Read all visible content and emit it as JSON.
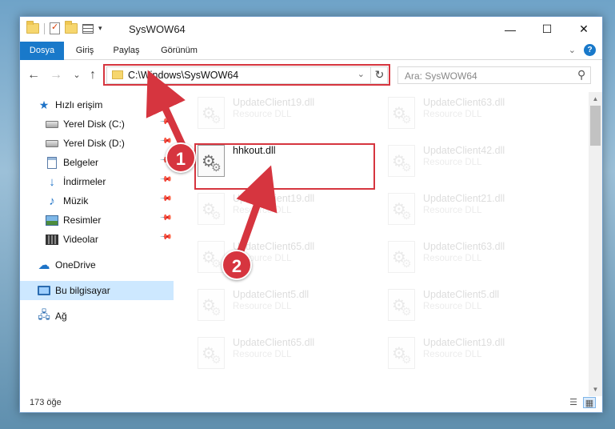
{
  "window": {
    "title": "SysWOW64",
    "controls": {
      "minimize": "—",
      "maximize": "☐",
      "close": "✕"
    }
  },
  "ribbon": {
    "tabs": [
      {
        "label": "Dosya"
      },
      {
        "label": "Giriş"
      },
      {
        "label": "Paylaş"
      },
      {
        "label": "Görünüm"
      }
    ],
    "help_label": "?"
  },
  "navigation": {
    "back_icon": "←",
    "forward_icon": "→",
    "recent_icon": "⌄",
    "up_icon": "↑",
    "address": "C:\\Windows\\SysWOW64",
    "refresh_icon": "↻",
    "search_placeholder": "Ara: SysWOW64"
  },
  "sidebar": {
    "items": [
      {
        "label": "Hızlı erişim",
        "icon": "star-icon"
      },
      {
        "label": "Yerel Disk (C:)",
        "icon": "disk-icon",
        "pinned": true
      },
      {
        "label": "Yerel Disk (D:)",
        "icon": "disk-icon",
        "pinned": true
      },
      {
        "label": "Belgeler",
        "icon": "documents-icon",
        "pinned": true
      },
      {
        "label": "İndirmeler",
        "icon": "downloads-icon",
        "pinned": true
      },
      {
        "label": "Müzik",
        "icon": "music-icon",
        "pinned": true
      },
      {
        "label": "Resimler",
        "icon": "pictures-icon",
        "pinned": true
      },
      {
        "label": "Videolar",
        "icon": "videos-icon",
        "pinned": true
      },
      {
        "label": "OneDrive",
        "icon": "onedrive-icon"
      },
      {
        "label": "Bu bilgisayar",
        "icon": "this-pc-icon",
        "selected": true
      },
      {
        "label": "Ağ",
        "icon": "network-icon"
      }
    ]
  },
  "files": [
    {
      "name": "UpdateClient19.dll",
      "type": "Resource DLL"
    },
    {
      "name": "UpdateClient63.dll",
      "type": "Resource DLL"
    },
    {
      "name": "hhkout.dll",
      "type": ""
    },
    {
      "name": "UpdateClient42.dll",
      "type": "Resource DLL"
    },
    {
      "name": "UpdateClient19.dll",
      "type": "Resource DLL"
    },
    {
      "name": "UpdateClient21.dll",
      "type": "Resource DLL"
    },
    {
      "name": "UpdateClient65.dll",
      "type": "Resource DLL"
    },
    {
      "name": "UpdateClient63.dll",
      "type": "Resource DLL"
    },
    {
      "name": "UpdateClient5.dll",
      "type": "Resource DLL"
    },
    {
      "name": "UpdateClient5.dll",
      "type": "Resource DLL"
    },
    {
      "name": "UpdateClient65.dll",
      "type": "Resource DLL"
    },
    {
      "name": "UpdateClient19.dll",
      "type": "Resource DLL"
    }
  ],
  "status": {
    "item_count": "173 öğe"
  },
  "annotations": {
    "step1": "1",
    "step2": "2",
    "color": "#d6353f"
  }
}
